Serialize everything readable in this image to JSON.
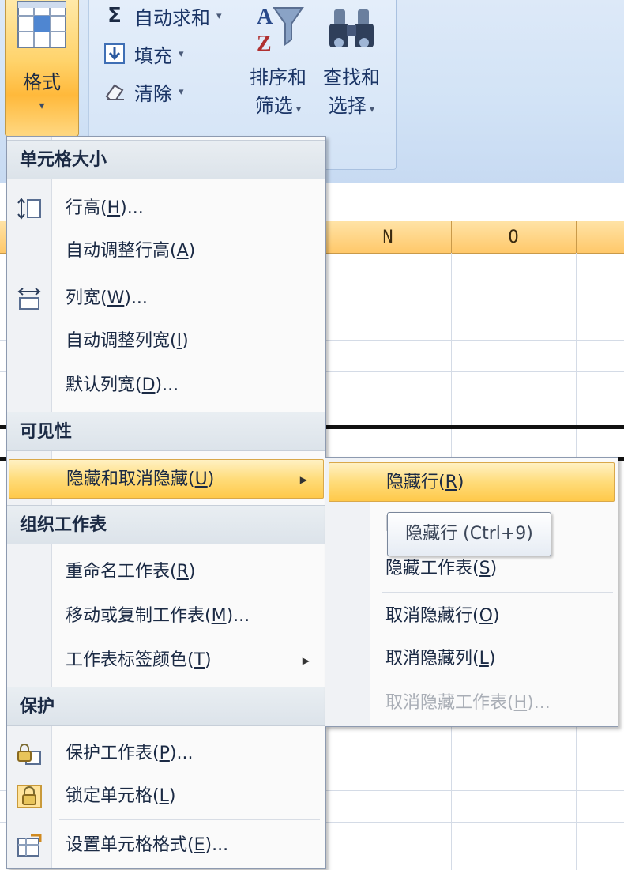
{
  "ribbon": {
    "format_button": {
      "label": "格式",
      "caret": "▾"
    },
    "autosum": {
      "label": "自动求和",
      "caret": "▾"
    },
    "fill": {
      "label": "填充",
      "caret": "▾"
    },
    "clear": {
      "label": "清除",
      "caret": "▾"
    },
    "sort_filter": {
      "line1": "排序和",
      "line2": "筛选",
      "caret": "▾"
    },
    "find_select": {
      "line1": "查找和",
      "line2": "选择",
      "caret": "▾"
    }
  },
  "sheet": {
    "columns": [
      "N",
      "O"
    ]
  },
  "menu": {
    "sections": {
      "cell_size": "单元格大小",
      "visibility": "可见性",
      "organize": "组织工作表",
      "protection": "保护"
    },
    "items": {
      "row_height": {
        "pre": "行高(",
        "key": "H",
        "post": ")..."
      },
      "autofit_row": {
        "pre": "自动调整行高(",
        "key": "A",
        "post": ")"
      },
      "col_width": {
        "pre": "列宽(",
        "key": "W",
        "post": ")..."
      },
      "autofit_col": {
        "pre": "自动调整列宽(",
        "key": "I",
        "post": ")"
      },
      "default_width": {
        "pre": "默认列宽(",
        "key": "D",
        "post": ")..."
      },
      "hide_unhide": {
        "pre": "隐藏和取消隐藏(",
        "key": "U",
        "post": ")"
      },
      "rename": {
        "pre": "重命名工作表(",
        "key": "R",
        "post": ")"
      },
      "move_copy": {
        "pre": "移动或复制工作表(",
        "key": "M",
        "post": ")..."
      },
      "tab_color": {
        "pre": "工作表标签颜色(",
        "key": "T",
        "post": ")"
      },
      "protect_sheet": {
        "pre": "保护工作表(",
        "key": "P",
        "post": ")..."
      },
      "lock_cell": {
        "pre": "锁定单元格(",
        "key": "L",
        "post": ")"
      },
      "format_cells": {
        "pre": "设置单元格格式(",
        "key": "E",
        "post": ")..."
      }
    },
    "arrow": "▶"
  },
  "submenu": {
    "items": {
      "hide_rows": {
        "pre": "隐藏行(",
        "key": "R",
        "post": ")"
      },
      "hide_cols": {
        "pre": "隐",
        "key": "",
        "post": ""
      },
      "hide_sheet": {
        "pre": "隐藏工作表(",
        "key": "S",
        "post": ")"
      },
      "unhide_rows": {
        "pre": "取消隐藏行(",
        "key": "O",
        "post": ")"
      },
      "unhide_cols": {
        "pre": "取消隐藏列(",
        "key": "L",
        "post": ")"
      },
      "unhide_sheet": {
        "pre": "取消隐藏工作表(",
        "key": "H",
        "post": ")..."
      }
    }
  },
  "tooltip": {
    "text": "隐藏行 (Ctrl+9)"
  },
  "colors": {
    "hover_gradient": "#ffdc7a",
    "ribbon_bg": "#d2e3f6",
    "header_orange": "#ffc86a"
  }
}
